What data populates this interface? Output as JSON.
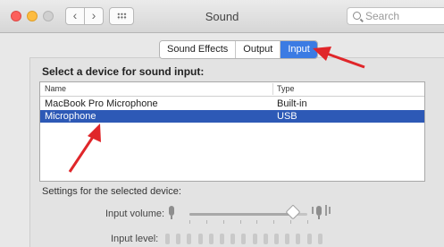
{
  "window": {
    "title": "Sound",
    "search_placeholder": "Search"
  },
  "toolbar": {
    "back_glyph": "‹",
    "forward_glyph": "›"
  },
  "tabs": [
    {
      "label": "Sound Effects",
      "selected": false
    },
    {
      "label": "Output",
      "selected": false
    },
    {
      "label": "Input",
      "selected": true
    }
  ],
  "input_panel": {
    "device_prompt": "Select a device for sound input:",
    "columns": {
      "name": "Name",
      "type": "Type"
    },
    "devices": [
      {
        "name": "MacBook Pro Microphone",
        "type": "Built-in",
        "selected": false
      },
      {
        "name": "Microphone",
        "type": "USB",
        "selected": true
      }
    ],
    "settings_label": "Settings for the selected device:",
    "input_volume_label": "Input volume:",
    "input_volume_fraction": 0.88,
    "input_level_label": "Input level:",
    "input_level_lit": 0,
    "input_level_total": 15
  },
  "colors": {
    "selection": "#2d59b6",
    "active_tab": "#3b7be3",
    "annotation_arrow": "#e0262a"
  },
  "icons": [
    "close-button",
    "minimize-button",
    "zoom-button",
    "chevron-left-icon",
    "chevron-right-icon",
    "grid-icon",
    "search-icon",
    "microphone-icon",
    "sound-wave-icon"
  ]
}
